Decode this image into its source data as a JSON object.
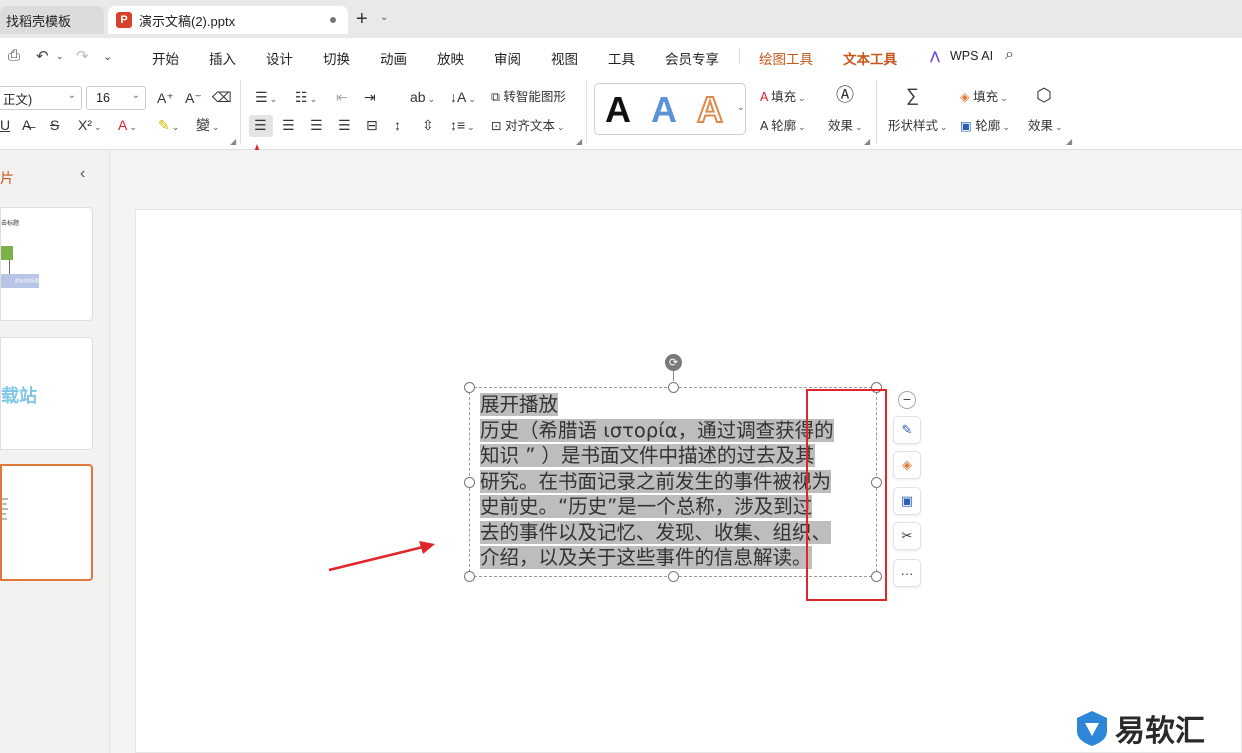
{
  "tabs": {
    "inactive_label": "找稻壳模板",
    "active_label": "演示文稿(2).pptx",
    "ppt_icon_letter": "P"
  },
  "menu": {
    "items": [
      "开始",
      "插入",
      "设计",
      "切换",
      "动画",
      "放映",
      "审阅",
      "视图",
      "工具",
      "会员专享",
      "绘图工具",
      "文本工具",
      "WPS AI"
    ],
    "active": "文本工具"
  },
  "ribbon": {
    "font_name": "正文)",
    "font_size": "16",
    "smart_art_label": "转智能图形",
    "align_text_label": "对齐文本",
    "fill_label": "填充",
    "outline_label": "轮廓",
    "effect_label": "效果",
    "shape_style_label": "形状样式",
    "fill2_label": "填充",
    "outline2_label": "轮廓",
    "effect2_label": "效果",
    "text_style_letter": "A"
  },
  "sidebar": {
    "title_fragment": "片",
    "thumb1_title": "击标题",
    "thumb1_caption": "此处添加标题",
    "thumb2_text": "载站"
  },
  "slide": {
    "textbox_lines": [
      "展开播放",
      "历史（希腊语 ιστορία，通过调查获得的",
      "知识 ” ）是书面文件中描述的过去及其",
      "研究。在书面记录之前发生的事件被视为",
      "史前史。“历史”是一个总称，涉及到过",
      "去的事件以及记忆、发现、收集、组织、",
      "介绍，以及关于这些事件的信息解读。"
    ]
  },
  "floating_toolbar": {
    "more_label": "···"
  },
  "watermark": {
    "text": "易软汇"
  },
  "colors": {
    "accent_orange": "#c7561a",
    "annotation_red": "#e0262a",
    "selection_gray": "#bdbdbd"
  }
}
